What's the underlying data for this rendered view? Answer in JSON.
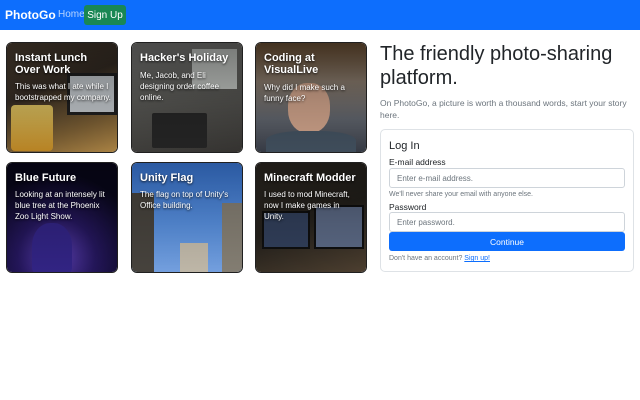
{
  "navbar": {
    "brand": "PhotoGo",
    "home": "Home",
    "signup": "Sign Up"
  },
  "cards": [
    {
      "title": "Instant Lunch Over Work",
      "desc": "This was what I ate while I bootstrapped my company."
    },
    {
      "title": "Hacker's Holiday",
      "desc": "Me, Jacob, and Eli designing order coffee online."
    },
    {
      "title": "Coding at VisualLive",
      "desc": "Why did I make such a funny face?"
    },
    {
      "title": "Blue Future",
      "desc": "Looking at an intensely lit blue tree at the Phoenix Zoo Light Show."
    },
    {
      "title": "Unity Flag",
      "desc": "The flag on top of Unity's Office building."
    },
    {
      "title": "Minecraft Modder",
      "desc": "I used to mod Minecraft, now I make games in Unity."
    }
  ],
  "hero": {
    "title": "The friendly photo-sharing platform.",
    "subtitle": "On PhotoGo, a picture is worth a thousand words, start your story here."
  },
  "login": {
    "title": "Log In",
    "email_label": "E-mail address",
    "email_placeholder": "Enter e-mail address.",
    "email_help": "We'll never share your email with anyone else.",
    "password_label": "Password",
    "password_placeholder": "Enter password.",
    "continue": "Continue",
    "no_account": "Don't have an account?",
    "signup_link": "Sign up!"
  },
  "colors": {
    "primary": "#0d6efd",
    "success": "#198754"
  }
}
